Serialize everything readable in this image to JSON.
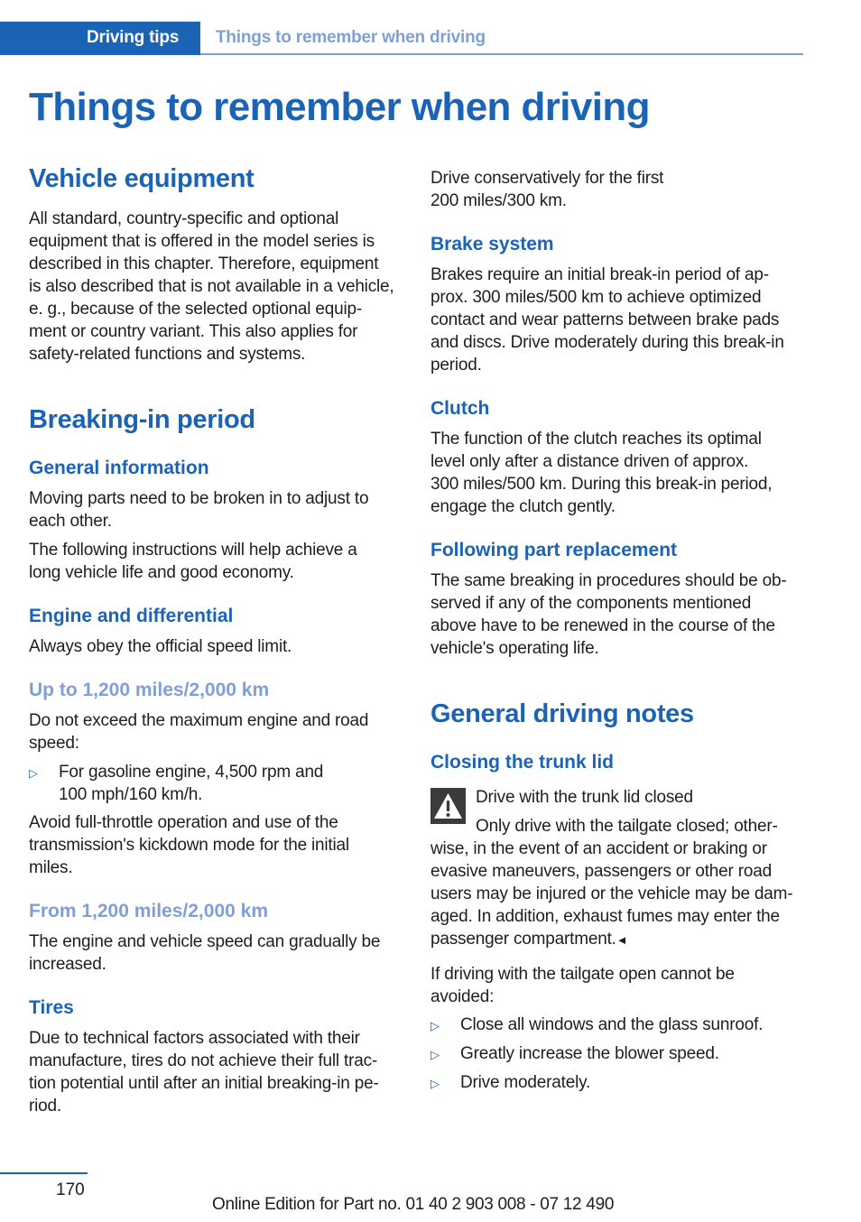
{
  "header": {
    "chapter": "Driving tips",
    "section": "Things to remember when driving"
  },
  "page_title": "Things to remember when driving",
  "left_column": {
    "vehicle_equipment": {
      "heading": "Vehicle equipment",
      "body_lines": [
        "All standard, country-specific and optional",
        "equipment that is offered in the model series is",
        "described in this chapter. Therefore, equipment",
        "is also described that is not available in a vehicle,",
        "e. g., because of the selected optional equip-",
        "ment or country variant. This also applies for",
        "safety-related functions and systems."
      ]
    },
    "breaking_in": {
      "heading": "Breaking-in period",
      "general_information": {
        "heading": "General information",
        "para1_lines": [
          "Moving parts need to be broken in to adjust to",
          "each other."
        ],
        "para2_lines": [
          "The following instructions will help achieve a",
          "long vehicle life and good economy."
        ]
      },
      "engine_differential": {
        "heading": "Engine and differential",
        "body": "Always obey the official speed limit."
      },
      "up_to": {
        "heading": "Up to 1,200 miles/2,000 km",
        "intro_lines": [
          "Do not exceed the maximum engine and road",
          "speed:"
        ],
        "bullet_lines": [
          "For gasoline engine, 4,500 rpm and",
          "100 mph/160 km/h."
        ],
        "after_lines": [
          "Avoid full-throttle operation and use of the",
          "transmission's kickdown mode for the initial",
          "miles."
        ]
      },
      "from": {
        "heading": "From 1,200 miles/2,000 km",
        "body_lines": [
          "The engine and vehicle speed can gradually be",
          "increased."
        ]
      },
      "tires": {
        "heading": "Tires",
        "body_lines": [
          "Due to technical factors associated with their",
          "manufacture, tires do not achieve their full trac-",
          "tion potential until after an initial breaking-in pe-",
          "riod."
        ]
      }
    }
  },
  "right_column": {
    "drive_conservatively_lines": [
      "Drive conservatively for the first",
      "200 miles/300 km."
    ],
    "brake_system": {
      "heading": "Brake system",
      "body_lines": [
        "Brakes require an initial break-in period of ap-",
        "prox. 300 miles/500 km to achieve optimized",
        "contact and wear patterns between brake pads",
        "and discs. Drive moderately during this break-in",
        "period."
      ]
    },
    "clutch": {
      "heading": "Clutch",
      "body_lines": [
        "The function of the clutch reaches its optimal",
        "level only after a distance driven of approx.",
        "300 miles/500 km. During this break-in period,",
        "engage the clutch gently."
      ]
    },
    "part_replacement": {
      "heading": "Following part replacement",
      "body_lines": [
        "The same breaking in procedures should be ob-",
        "served if any of the components mentioned",
        "above have to be renewed in the course of the",
        "vehicle's operating life."
      ]
    },
    "general_driving_notes": {
      "heading": "General driving notes",
      "closing_trunk_lid": {
        "heading": "Closing the trunk lid",
        "warning_icon": "warning-triangle-icon",
        "warning_title": "Drive with the trunk lid closed",
        "warning_lines": [
          "Only drive with the tailgate closed; other-",
          "wise, in the event of an accident or braking or",
          "evasive maneuvers, passengers or other road",
          "users may be injured or the vehicle may be dam-",
          "aged. In addition, exhaust fumes may enter the",
          "passenger compartment."
        ],
        "end_mark": "◄",
        "intro_lines": [
          "If driving with the tailgate open cannot be",
          "avoided:"
        ],
        "bullets": [
          "Close all windows and the glass sunroof.",
          "Greatly increase the blower speed.",
          "Drive moderately."
        ]
      }
    }
  },
  "bullet_marker": "▷",
  "footer": {
    "page_number": "170",
    "edition": "Online Edition for Part no. 01 40 2 903 008 - 07 12 490"
  },
  "colors": {
    "primary_blue": "#1b63b5",
    "light_blue": "#7f9fd6",
    "text": "#1e1e1e",
    "warning_icon_bg": "#3b3b3b"
  }
}
